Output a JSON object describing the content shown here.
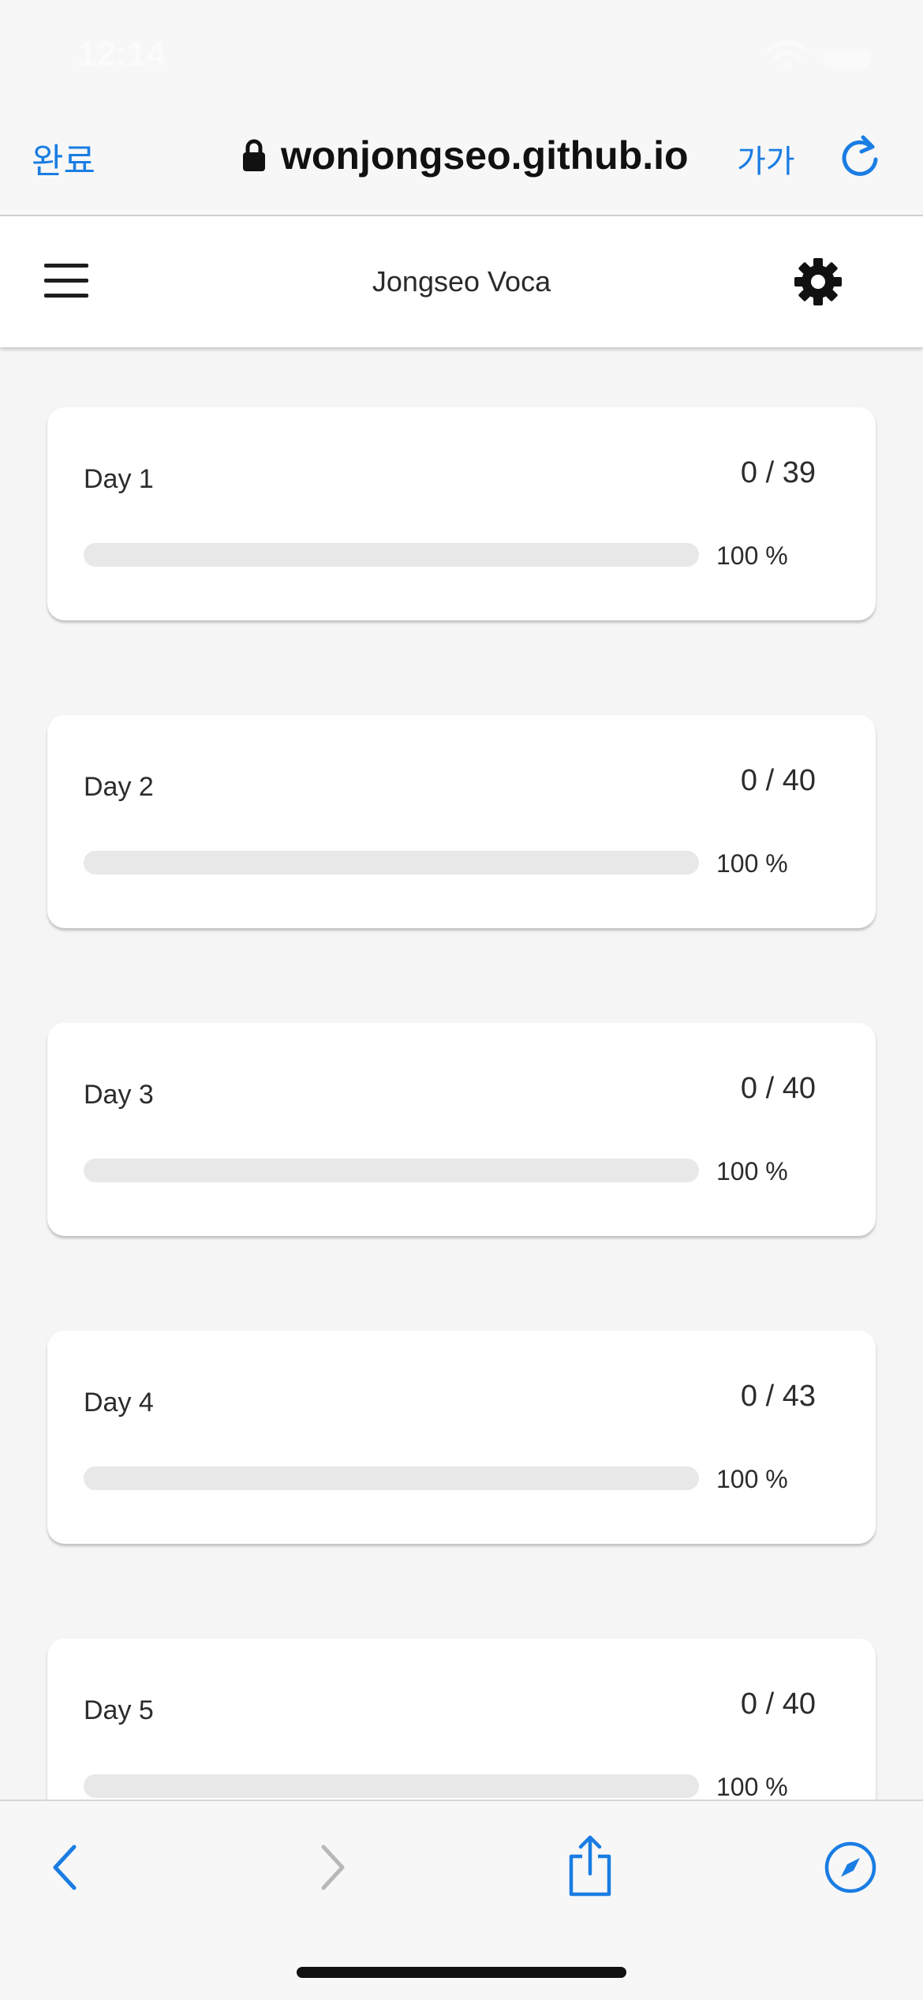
{
  "status": {
    "time": "12:14"
  },
  "browser": {
    "done_label": "완료",
    "url": "wonjongseo.github.io",
    "text_size_label": "가가"
  },
  "app": {
    "title": "Jongseo Voca"
  },
  "days": [
    {
      "title": "Day 1",
      "count": "0 / 39",
      "percent_label": "100 %"
    },
    {
      "title": "Day 2",
      "count": "0 / 40",
      "percent_label": "100 %"
    },
    {
      "title": "Day 3",
      "count": "0 / 40",
      "percent_label": "100 %"
    },
    {
      "title": "Day 4",
      "count": "0 / 43",
      "percent_label": "100 %"
    },
    {
      "title": "Day 5",
      "count": "0 / 40",
      "percent_label": "100 %"
    }
  ],
  "colors": {
    "accent": "#1a7de3",
    "bar_track": "#e8e8e8"
  }
}
